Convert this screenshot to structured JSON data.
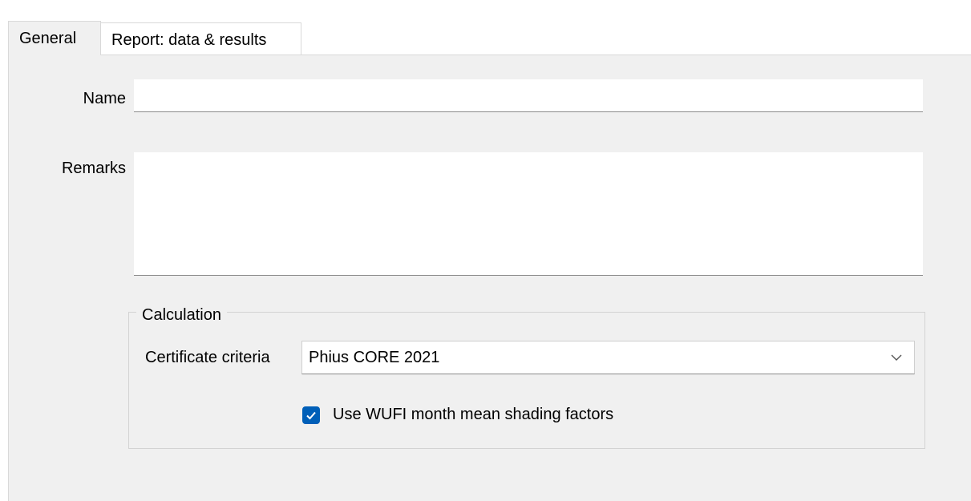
{
  "tabs": [
    {
      "label": "General",
      "selected": true
    },
    {
      "label": "Report: data & results",
      "selected": false
    }
  ],
  "general": {
    "name_label": "Name",
    "name_value": "",
    "remarks_label": "Remarks",
    "remarks_value": "",
    "calculation": {
      "group_title": "Calculation",
      "criteria_label": "Certificate criteria",
      "criteria_value": "Phius CORE 2021",
      "shading_checkbox_label": "Use WUFI month mean shading factors",
      "shading_checkbox_checked": true
    }
  },
  "colors": {
    "accent": "#005fb8",
    "panel_background": "#f0f0f0",
    "field_background": "#ffffff"
  },
  "icons": {
    "combo_arrow": "chevron-down-icon",
    "checkbox_mark": "checkmark-icon"
  }
}
